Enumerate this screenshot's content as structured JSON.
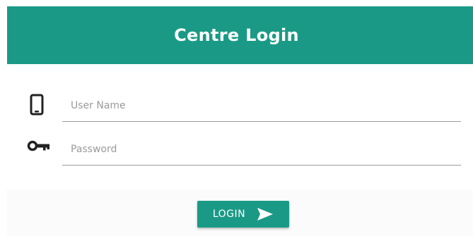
{
  "header": {
    "title": "Centre Login"
  },
  "form": {
    "username": {
      "placeholder": "User Name",
      "value": "",
      "icon": "mobile-phone-icon"
    },
    "password": {
      "placeholder": "Password",
      "value": "",
      "icon": "key-icon"
    }
  },
  "actions": {
    "login_label": "LOGIN",
    "login_icon": "send-arrow-icon"
  },
  "colors": {
    "accent": "#1a9a86",
    "text_on_accent": "#ffffff",
    "placeholder": "#9a9a9a",
    "icon": "#222222"
  }
}
